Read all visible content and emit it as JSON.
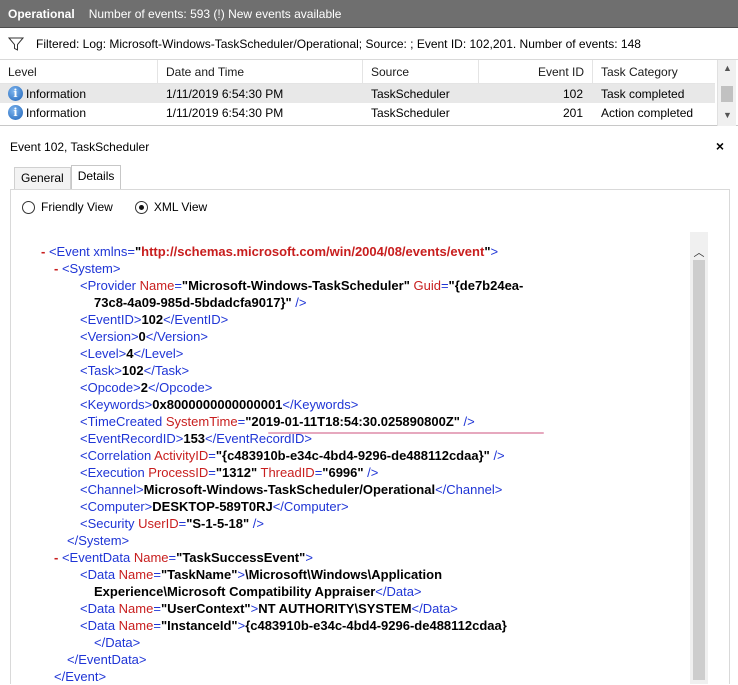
{
  "header": {
    "title": "Operational",
    "count_text": "Number of events: 593 (!) New events available"
  },
  "filter": {
    "text": "Filtered: Log: Microsoft-Windows-TaskScheduler/Operational; Source: ; Event ID: 102,201. Number of events: 148"
  },
  "grid": {
    "columns": [
      "Level",
      "Date and Time",
      "Source",
      "Event ID",
      "Task Category"
    ],
    "rows": [
      [
        "Information",
        "1/11/2019 6:54:30 PM",
        "TaskScheduler",
        "102",
        "Task completed"
      ],
      [
        "Information",
        "1/11/2019 6:54:30 PM",
        "TaskScheduler",
        "201",
        "Action completed"
      ]
    ]
  },
  "event_panel": {
    "title": "Event 102, TaskScheduler",
    "close": "×",
    "tabs": [
      "General",
      "Details"
    ],
    "views": [
      "Friendly View",
      "XML View"
    ]
  },
  "xml": {
    "ns_attr": "xmlns=",
    "ns_url": "http://schemas.microsoft.com/win/2004/08/events/event",
    "provider_name": "Microsoft-Windows-TaskScheduler",
    "guid_1": "{de7b24ea-",
    "guid_2": "73c8-4a09-985d-5bdadcfa9017}",
    "event_id": "102",
    "version": "0",
    "level": "4",
    "task": "102",
    "opcode": "2",
    "keywords": "0x8000000000000001",
    "system_time": "2019-01-11T18:54:30.025890800Z",
    "record_id": "153",
    "activity_id": "{c483910b-e34c-4bd4-9296-de488112cdaa}",
    "process_id": "1312",
    "thread_id": "6996",
    "channel": "Microsoft-Windows-TaskScheduler/Operational",
    "computer": "DESKTOP-589T0RJ",
    "user_id": "S-1-5-18",
    "eventdata_name": "TaskSuccessEvent",
    "task_name_1": "\\Microsoft\\Windows\\Application",
    "task_name_2": "Experience\\Microsoft Compatibility Appraiser",
    "user_context": "NT AUTHORITY\\SYSTEM",
    "instance_id": "{c483910b-e34c-4bd4-9296-de488112cdaa}",
    "data_names": [
      "TaskName",
      "UserContext",
      "InstanceId"
    ]
  }
}
